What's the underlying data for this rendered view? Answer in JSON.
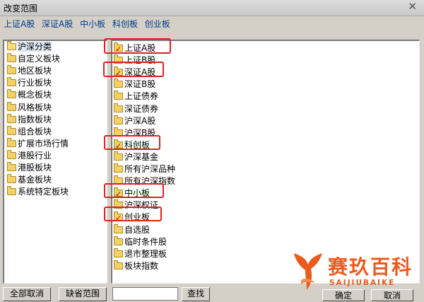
{
  "window": {
    "title": "改变范围",
    "close_glyph": "✕"
  },
  "selected_summary": [
    "上证A股",
    "深证A股",
    "中小板",
    "科创板",
    "创业板"
  ],
  "left_tree": [
    {
      "label": "沪深分类",
      "open": true,
      "selected": true
    },
    {
      "label": "自定义板块"
    },
    {
      "label": "地区板块"
    },
    {
      "label": "行业板块"
    },
    {
      "label": "概念板块"
    },
    {
      "label": "风格板块"
    },
    {
      "label": "指数板块"
    },
    {
      "label": "组合板块"
    },
    {
      "label": "扩展市场行情"
    },
    {
      "label": "港股行业"
    },
    {
      "label": "港股板块"
    },
    {
      "label": "基金板块"
    },
    {
      "label": "系统特定板块"
    }
  ],
  "right_list": [
    {
      "label": "上证A股",
      "checked": true
    },
    {
      "label": "上证B股"
    },
    {
      "label": "深证A股",
      "checked": true
    },
    {
      "label": "深证B股"
    },
    {
      "label": "上证债券"
    },
    {
      "label": "深证债券"
    },
    {
      "label": "沪深A股"
    },
    {
      "label": "沪深B股"
    },
    {
      "label": "科创板",
      "checked": true
    },
    {
      "label": "沪深基金"
    },
    {
      "label": "所有沪深品种"
    },
    {
      "label": "所有沪深指数"
    },
    {
      "label": "中小板",
      "checked": true
    },
    {
      "label": "沪深权证"
    },
    {
      "label": "创业板",
      "checked": true
    },
    {
      "label": "自选股"
    },
    {
      "label": "临时条件股"
    },
    {
      "label": "退市整理板"
    },
    {
      "label": "板块指数"
    }
  ],
  "buttons": {
    "clear_all": "全部取消",
    "default_range": "缺省范围",
    "search": "查找",
    "ok": "确定",
    "cancel": "取消"
  },
  "search": {
    "value": ""
  },
  "watermark": {
    "brand_cn": "赛玖百科",
    "brand_en": "SAIJIUBAIKE",
    "color": "#ec5a1e"
  },
  "colors": {
    "highlight_box": "#e02020",
    "summary_text": "#003a8c"
  }
}
